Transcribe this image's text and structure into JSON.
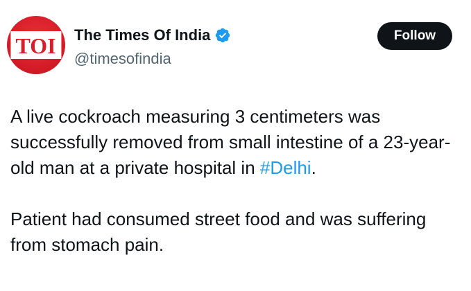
{
  "account": {
    "avatar_text": "TOI",
    "display_name": "The Times Of India",
    "handle": "@timesofindia",
    "verified": true
  },
  "follow_button": {
    "label": "Follow"
  },
  "tweet": {
    "para1_before": "A live cockroach measuring 3 centimeters was successfully removed from small intestine of a 23-year-old man at a private hospital in ",
    "hashtag": "#Delhi",
    "para1_after": ".",
    "para2": "Patient had consumed street food and was suffering from stomach pain."
  },
  "colors": {
    "brand_red": "#d81e2a",
    "verified_blue": "#1d9bf0",
    "link_blue": "#1d9bf0",
    "text": "#0f1419",
    "secondary_text": "#536471",
    "button_bg": "#0f1419"
  },
  "icons": {
    "verified": "verified-badge-icon"
  }
}
